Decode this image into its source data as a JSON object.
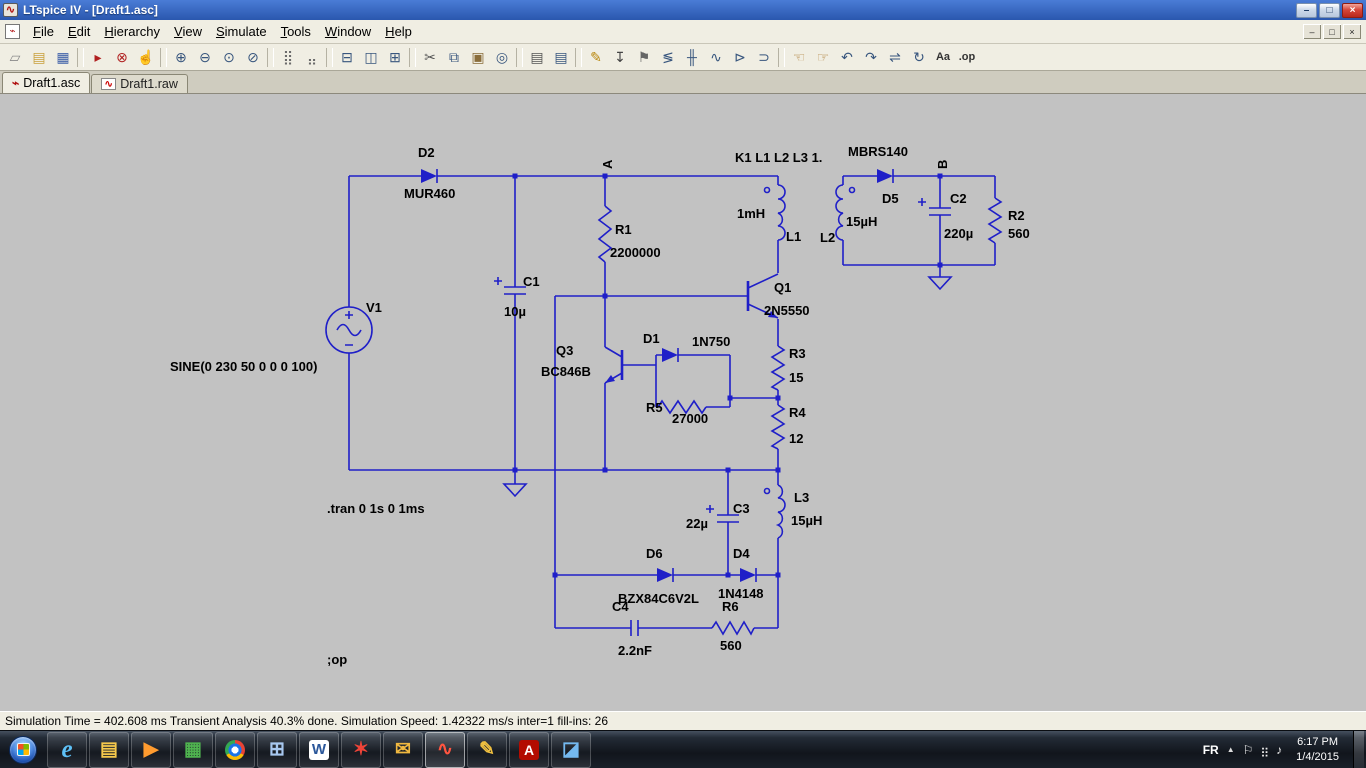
{
  "titlebar": {
    "icon_glyph": "∿",
    "title": "LTspice IV - [Draft1.asc]",
    "buttons": [
      {
        "name": "minimize-button",
        "glyph": "–"
      },
      {
        "name": "maximize-button",
        "glyph": "□"
      },
      {
        "name": "close-button",
        "glyph": "×"
      }
    ]
  },
  "menubar": {
    "icon_glyph": "⌁",
    "items": [
      {
        "name": "menu-file",
        "label": "File"
      },
      {
        "name": "menu-edit",
        "label": "Edit"
      },
      {
        "name": "menu-hierarchy",
        "label": "Hierarchy"
      },
      {
        "name": "menu-view",
        "label": "View"
      },
      {
        "name": "menu-simulate",
        "label": "Simulate"
      },
      {
        "name": "menu-tools",
        "label": "Tools"
      },
      {
        "name": "menu-window",
        "label": "Window"
      },
      {
        "name": "menu-help",
        "label": "Help"
      }
    ],
    "mdi_buttons": [
      {
        "name": "mdi-minimize-button",
        "glyph": "–"
      },
      {
        "name": "mdi-restore-button",
        "glyph": "□"
      },
      {
        "name": "mdi-close-button",
        "glyph": "×"
      }
    ]
  },
  "toolbar": {
    "buttons": [
      {
        "name": "new-schematic-icon",
        "glyph": "▱",
        "color": "#8a8a8a"
      },
      {
        "name": "open-icon",
        "glyph": "▤",
        "color": "#c9a03c"
      },
      {
        "name": "save-icon",
        "glyph": "▦",
        "color": "#3d5fa8"
      },
      {
        "name": "toolbar-separator"
      },
      {
        "name": "run-icon",
        "glyph": "▸",
        "color": "#b02020"
      },
      {
        "name": "halt-icon",
        "glyph": "⊗",
        "color": "#b02020"
      },
      {
        "name": "pan-icon",
        "glyph": "☝",
        "color": "#b58a4a"
      },
      {
        "name": "toolbar-separator"
      },
      {
        "name": "zoom-in-icon",
        "glyph": "⊕",
        "color": "#38567e"
      },
      {
        "name": "zoom-out-icon",
        "glyph": "⊖",
        "color": "#38567e"
      },
      {
        "name": "zoom-extents-icon",
        "glyph": "⊙",
        "color": "#38567e"
      },
      {
        "name": "zoom-fit-icon",
        "glyph": "⊘",
        "color": "#38567e"
      },
      {
        "name": "toolbar-separator"
      },
      {
        "name": "grid-icon",
        "glyph": "⣿",
        "color": "#6a6a6a"
      },
      {
        "name": "snap-icon",
        "glyph": "⣤",
        "color": "#6a6a6a"
      },
      {
        "name": "toolbar-separator"
      },
      {
        "name": "tile-horizontal-icon",
        "glyph": "⊟",
        "color": "#38567e"
      },
      {
        "name": "tile-vertical-icon",
        "glyph": "◫",
        "color": "#38567e"
      },
      {
        "name": "cascade-icon",
        "glyph": "⊞",
        "color": "#38567e"
      },
      {
        "name": "toolbar-separator"
      },
      {
        "name": "cut-icon",
        "glyph": "✂",
        "color": "#555555"
      },
      {
        "name": "copy-icon",
        "glyph": "⧉",
        "color": "#38567e"
      },
      {
        "name": "paste-icon",
        "glyph": "▣",
        "color": "#8a6d3b"
      },
      {
        "name": "find-icon",
        "glyph": "◎",
        "color": "#38567e"
      },
      {
        "name": "toolbar-separator"
      },
      {
        "name": "print-preview-icon",
        "glyph": "▤",
        "color": "#555555"
      },
      {
        "name": "print-icon",
        "glyph": "▤",
        "color": "#38567e"
      },
      {
        "name": "toolbar-separator"
      },
      {
        "name": "wire-icon",
        "glyph": "✎",
        "color": "#b8860b"
      },
      {
        "name": "ground-icon",
        "glyph": "↧",
        "color": "#444444"
      },
      {
        "name": "net-label-icon",
        "glyph": "⚑",
        "color": "#666666"
      },
      {
        "name": "resistor-icon",
        "glyph": "≶",
        "color": "#38567e"
      },
      {
        "name": "capacitor-icon",
        "glyph": "╫",
        "color": "#38567e"
      },
      {
        "name": "inductor-icon",
        "glyph": "∿",
        "color": "#38567e"
      },
      {
        "name": "diode-icon",
        "glyph": "⊳",
        "color": "#38567e"
      },
      {
        "name": "component-icon",
        "glyph": "⊃",
        "color": "#38567e"
      },
      {
        "name": "toolbar-separator"
      },
      {
        "name": "move-icon",
        "glyph": "☜",
        "color": "#b58a4a"
      },
      {
        "name": "drag-icon",
        "glyph": "☞",
        "color": "#b58a4a"
      },
      {
        "name": "undo-icon",
        "glyph": "↶",
        "color": "#38567e"
      },
      {
        "name": "redo-icon",
        "glyph": "↷",
        "color": "#38567e"
      },
      {
        "name": "mirror-icon",
        "glyph": "⇌",
        "color": "#38567e"
      },
      {
        "name": "rotate-icon",
        "glyph": "↻",
        "color": "#38567e"
      },
      {
        "name": "text-icon",
        "glyph": "Aa",
        "color": "#333333"
      },
      {
        "name": "spice-directive-icon",
        "glyph": ".op",
        "color": "#333333"
      }
    ]
  },
  "tabs": [
    {
      "name": "tab-draft1-asc",
      "label": "Draft1.asc",
      "icon_glyph": "⌁"
    },
    {
      "name": "tab-draft1-raw",
      "label": "Draft1.raw",
      "icon_glyph": "∿"
    }
  ],
  "schematic": {
    "wire_color": "#1f1fc8",
    "components": {
      "v1": {
        "name": "V1",
        "value": "SINE(0 230 50 0 0 0 100)"
      },
      "d2": {
        "name": "D2",
        "value": "MUR460"
      },
      "c1": {
        "name": "C1",
        "value": "10µ"
      },
      "r1": {
        "name": "R1",
        "value": "2200000"
      },
      "q1": {
        "name": "Q1",
        "value": "2N5550"
      },
      "q3": {
        "name": "Q3",
        "value": "BC846B"
      },
      "d1": {
        "name": "D1",
        "value": "1N750"
      },
      "r5": {
        "name": "R5",
        "value": "27000"
      },
      "r3": {
        "name": "R3",
        "value": "15"
      },
      "r4": {
        "name": "R4",
        "value": "12"
      },
      "l1": {
        "name": "L1",
        "value": "1mH"
      },
      "l2": {
        "name": "L2",
        "value": "15µH"
      },
      "l3": {
        "name": "L3",
        "value": "15µH"
      },
      "d5": {
        "name": "D5",
        "value": "MBRS140"
      },
      "c2": {
        "name": "C2",
        "value": "220µ"
      },
      "r2": {
        "name": "R2",
        "value": "560"
      },
      "c3": {
        "name": "C3",
        "value": "22µ"
      },
      "d6": {
        "name": "D6",
        "value": "BZX84C6V2L"
      },
      "d4": {
        "name": "D4",
        "value": "1N4148"
      },
      "c4": {
        "name": "C4",
        "value": "2.2nF"
      },
      "r6": {
        "name": "R6",
        "value": "560"
      }
    },
    "directives": {
      "coupling": "K1 L1 L2 L3 1.",
      "tran": ".tran 0 1s 0 1ms",
      "op": ";op"
    },
    "nodes": {
      "a": "A",
      "b": "B"
    }
  },
  "statusbar": {
    "text": "Simulation Time = 402.608 ms  Transient Analysis 40.3% done. Simulation Speed: 1.42322 ms/s inter=1 fill-ins: 26"
  },
  "taskbar": {
    "apps": [
      {
        "name": "ie-icon",
        "glyph": "e",
        "color": "#5ec1f7"
      },
      {
        "name": "explorer-icon",
        "glyph": "▤",
        "color": "#f5c84c"
      },
      {
        "name": "media-player-icon",
        "glyph": "▶",
        "color": "#ff9b2f"
      },
      {
        "name": "green-app-icon",
        "glyph": "▦",
        "color": "#4fb34f"
      },
      {
        "name": "chrome-icon",
        "glyph": "",
        "color": ""
      },
      {
        "name": "calculator-icon",
        "glyph": "⊞",
        "color": "#a8c8f0"
      },
      {
        "name": "word-icon",
        "glyph": "W",
        "color": "#2b579a"
      },
      {
        "name": "red-app-icon",
        "glyph": "✶",
        "color": "#f04438"
      },
      {
        "name": "mail-icon",
        "glyph": "✉",
        "color": "#f0b840"
      },
      {
        "name": "ltspice-icon",
        "glyph": "∿",
        "color": "#ff5540"
      },
      {
        "name": "paint-app-icon",
        "glyph": "✎",
        "color": "#f0c040"
      },
      {
        "name": "adobe-reader-icon",
        "glyph": "A",
        "color": "#ffffff"
      },
      {
        "name": "image-viewer-icon",
        "glyph": "◪",
        "color": "#74b9f0"
      }
    ],
    "tray": {
      "lang": "FR",
      "caret": "▲",
      "icons": [
        {
          "name": "action-center-icon",
          "glyph": "⚐"
        },
        {
          "name": "network-icon",
          "glyph": "⣶"
        },
        {
          "name": "volume-icon",
          "glyph": "♪"
        }
      ],
      "time": "6:17 PM",
      "date": "1/4/2015"
    }
  }
}
